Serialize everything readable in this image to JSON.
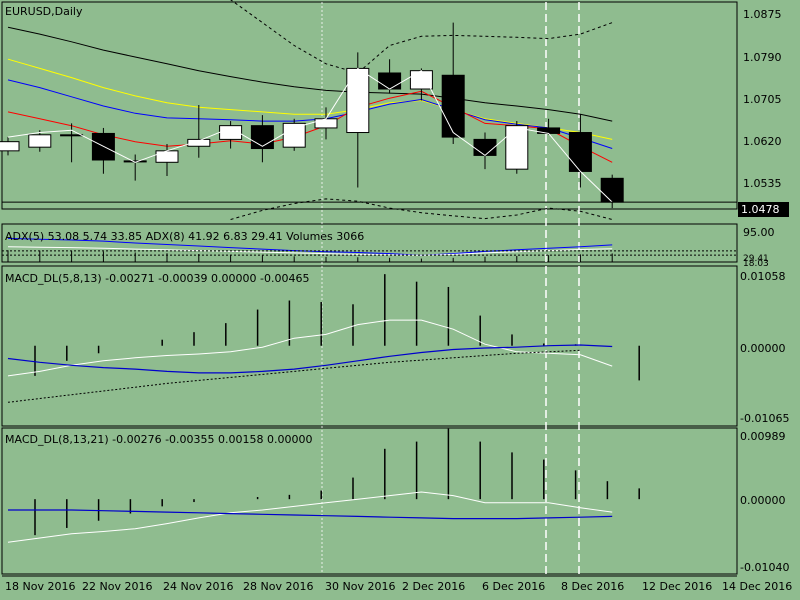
{
  "window": {
    "symbol_label": "EURUSD,Daily",
    "current_price": "1.0478"
  },
  "colors": {
    "background": "#8fbc8f",
    "bull_candle": "#ffffff",
    "bear_candle": "#000000",
    "ma_slow": "#000000",
    "ma_yellow": "#ffff00",
    "ma_blue": "#0000ff",
    "ma_red": "#ff0000",
    "indicator_white": "#ffffff",
    "indicator_blue": "#0000cc"
  },
  "panels": {
    "price": {
      "axis_labels": [
        "1.0875",
        "1.0790",
        "1.0705",
        "1.0620",
        "1.0535"
      ],
      "axis_values": [
        1.0875,
        1.079,
        1.0705,
        1.062,
        1.0535
      ]
    },
    "adx": {
      "title": "ADX(5) 53.08 5.74 33.85 ADX(8) 41.92 6.83 29.41 Volumes 3066",
      "axis_labels": [
        "95.00",
        "29.41",
        "18.03"
      ]
    },
    "macd1": {
      "title": "MACD_DL(5,8,13) -0.00271 -0.00039 0.00000 -0.00465",
      "axis_labels": [
        "0.01058",
        "0.00000",
        "-0.01065"
      ]
    },
    "macd2": {
      "title": "MACD_DL(8,13,21) -0.00276 -0.00355 0.00158 0.00000",
      "axis_labels": [
        "0.00989",
        "0.00000",
        "-0.01040"
      ]
    }
  },
  "date_axis": [
    "18 Nov 2016",
    "22 Nov 2016",
    "24 Nov 2016",
    "28 Nov 2016",
    "30 Nov 2016",
    "2 Dec 2016",
    "6 Dec 2016",
    "8 Dec 2016",
    "12 Dec 2016",
    "14 Dec 2016"
  ],
  "chart_data": {
    "type": "candlestick",
    "symbol": "EURUSD",
    "timeframe": "Daily",
    "ylim": [
      1.0463,
      1.0915
    ],
    "candles": [
      {
        "o": 1.059,
        "h": 1.062,
        "l": 1.058,
        "c": 1.061
      },
      {
        "o": 1.0598,
        "h": 1.0635,
        "l": 1.0588,
        "c": 1.0625
      },
      {
        "o": 1.0625,
        "h": 1.065,
        "l": 1.0565,
        "c": 1.0625
      },
      {
        "o": 1.0628,
        "h": 1.064,
        "l": 1.054,
        "c": 1.057
      },
      {
        "o": 1.0568,
        "h": 1.0582,
        "l": 1.0525,
        "c": 1.0568
      },
      {
        "o": 1.0565,
        "h": 1.0605,
        "l": 1.0535,
        "c": 1.059
      },
      {
        "o": 1.06,
        "h": 1.069,
        "l": 1.0575,
        "c": 1.0615
      },
      {
        "o": 1.0615,
        "h": 1.0655,
        "l": 1.0595,
        "c": 1.0645
      },
      {
        "o": 1.0645,
        "h": 1.0668,
        "l": 1.0565,
        "c": 1.0595
      },
      {
        "o": 1.0598,
        "h": 1.066,
        "l": 1.059,
        "c": 1.065
      },
      {
        "o": 1.064,
        "h": 1.0685,
        "l": 1.0615,
        "c": 1.066
      },
      {
        "o": 1.063,
        "h": 1.0805,
        "l": 1.051,
        "c": 1.077
      },
      {
        "o": 1.076,
        "h": 1.079,
        "l": 1.0715,
        "c": 1.0725
      },
      {
        "o": 1.0725,
        "h": 1.077,
        "l": 1.07,
        "c": 1.0765
      },
      {
        "o": 1.0755,
        "h": 1.087,
        "l": 1.0605,
        "c": 1.062
      },
      {
        "o": 1.0615,
        "h": 1.063,
        "l": 1.055,
        "c": 1.058
      },
      {
        "o": 1.055,
        "h": 1.0655,
        "l": 1.054,
        "c": 1.0645
      },
      {
        "o": 1.064,
        "h": 1.066,
        "l": 1.0625,
        "c": 1.0628
      },
      {
        "o": 1.063,
        "h": 1.067,
        "l": 1.051,
        "c": 1.0545
      },
      {
        "o": 1.053,
        "h": 1.0538,
        "l": 1.0465,
        "c": 1.0478
      }
    ],
    "ma_slow": [
      1.086,
      1.0845,
      1.0828,
      1.081,
      1.0795,
      1.078,
      1.0765,
      1.0752,
      1.074,
      1.073,
      1.0722,
      1.0718,
      1.0716,
      1.0714,
      1.0705,
      1.0695,
      1.0688,
      1.068,
      1.067,
      1.0655
    ],
    "ma_yellow": [
      1.079,
      1.077,
      1.075,
      1.0728,
      1.071,
      1.0695,
      1.0685,
      1.068,
      1.0675,
      1.067,
      1.067,
      1.068,
      1.0695,
      1.07,
      1.068,
      1.066,
      1.065,
      1.064,
      1.063,
      1.0615
    ],
    "ma_blue": [
      1.0745,
      1.0728,
      1.0708,
      1.0688,
      1.0672,
      1.0662,
      1.066,
      1.0658,
      1.0655,
      1.0655,
      1.066,
      1.0675,
      1.0692,
      1.0702,
      1.068,
      1.0658,
      1.0648,
      1.064,
      1.0618,
      1.0595
    ],
    "ma_red": [
      1.0675,
      1.066,
      1.0645,
      1.0625,
      1.061,
      1.06,
      1.0605,
      1.0612,
      1.0605,
      1.062,
      1.0645,
      1.0685,
      1.0705,
      1.072,
      1.0685,
      1.065,
      1.0645,
      1.0638,
      1.06,
      1.0565
    ],
    "ma_white": [
      1.062,
      1.063,
      1.0635,
      1.06,
      1.0565,
      1.059,
      1.0612,
      1.064,
      1.06,
      1.064,
      1.066,
      1.077,
      1.0725,
      1.0765,
      1.063,
      1.058,
      1.064,
      1.0628,
      1.0545,
      1.0478
    ],
    "envelope_upper": [
      null,
      null,
      null,
      null,
      null,
      null,
      1.096,
      1.092,
      1.087,
      1.082,
      1.078,
      1.076,
      1.082,
      1.084,
      1.0842,
      1.084,
      1.0838,
      1.0835,
      1.0845,
      1.087
    ],
    "envelope_lower": [
      null,
      null,
      null,
      null,
      null,
      null,
      null,
      1.044,
      1.046,
      1.0475,
      1.0485,
      1.048,
      1.0465,
      1.0455,
      1.0448,
      1.0442,
      1.045,
      1.0465,
      1.0458,
      1.044
    ],
    "adx_main": [
      62,
      60,
      58,
      55,
      50,
      46,
      42,
      38,
      34,
      30,
      27,
      25,
      22,
      18,
      22,
      28,
      32,
      36,
      40,
      45
    ],
    "adx_signal": [
      40,
      39,
      38,
      36,
      34,
      32,
      30,
      28,
      26,
      24,
      22,
      20,
      19,
      18,
      20,
      24,
      27,
      30,
      33,
      35
    ],
    "macd1_hist": [
      -0.004,
      -0.002,
      -0.001,
      0.0,
      0.0008,
      0.0018,
      0.003,
      0.0048,
      0.006,
      0.0058,
      0.0055,
      0.0095,
      0.0085,
      0.0078,
      0.004,
      0.0015,
      0.0003,
      0.0002,
      0.0,
      -0.0046
    ],
    "macd1_signal": [
      -0.004,
      -0.0034,
      -0.0026,
      -0.002,
      -0.0016,
      -0.0013,
      -0.0011,
      -0.0008,
      -0.0002,
      0.001,
      0.0015,
      0.0028,
      0.0034,
      0.0034,
      0.0022,
      0.0002,
      -0.0008,
      -0.001,
      -0.0012,
      -0.0027
    ],
    "macd1_blue": [
      -0.0017,
      -0.0022,
      -0.0026,
      -0.0029,
      -0.0031,
      -0.0034,
      -0.0036,
      -0.0036,
      -0.0034,
      -0.0031,
      -0.0026,
      -0.002,
      -0.0014,
      -0.0009,
      -0.0005,
      -0.0003,
      -0.0002,
      0.0,
      0.0001,
      -0.0001
    ],
    "macd1_dotted": [
      -0.0075,
      -0.007,
      -0.0065,
      -0.006,
      -0.0055,
      -0.005,
      -0.0046,
      -0.0042,
      -0.0038,
      -0.0034,
      -0.003,
      -0.0026,
      -0.0022,
      -0.0019,
      -0.0016,
      -0.0013,
      -0.001,
      -0.0008,
      -0.0006,
      null
    ],
    "macd2_hist": [
      -0.005,
      -0.004,
      -0.003,
      -0.002,
      -0.001,
      -0.0004,
      0.0,
      0.0003,
      0.0006,
      0.0012,
      0.003,
      0.007,
      0.008,
      0.0098,
      0.008,
      0.0065,
      0.0055,
      0.004,
      0.0025,
      0.0015
    ],
    "macd2_signal": [
      -0.006,
      -0.0054,
      -0.0048,
      -0.0045,
      -0.0041,
      -0.0034,
      -0.0026,
      -0.0019,
      -0.0015,
      -0.001,
      -0.0005,
      0.0,
      0.0005,
      0.001,
      0.0005,
      -0.0005,
      -0.0005,
      -0.0005,
      -0.0012,
      -0.0018
    ],
    "macd2_blue": [
      -0.0015,
      -0.0015,
      -0.0015,
      -0.0016,
      -0.0017,
      -0.0018,
      -0.0019,
      -0.002,
      -0.0021,
      -0.0022,
      -0.0023,
      -0.0024,
      -0.0025,
      -0.0026,
      -0.0027,
      -0.0027,
      -0.0027,
      -0.0026,
      -0.0025,
      -0.0024
    ]
  }
}
